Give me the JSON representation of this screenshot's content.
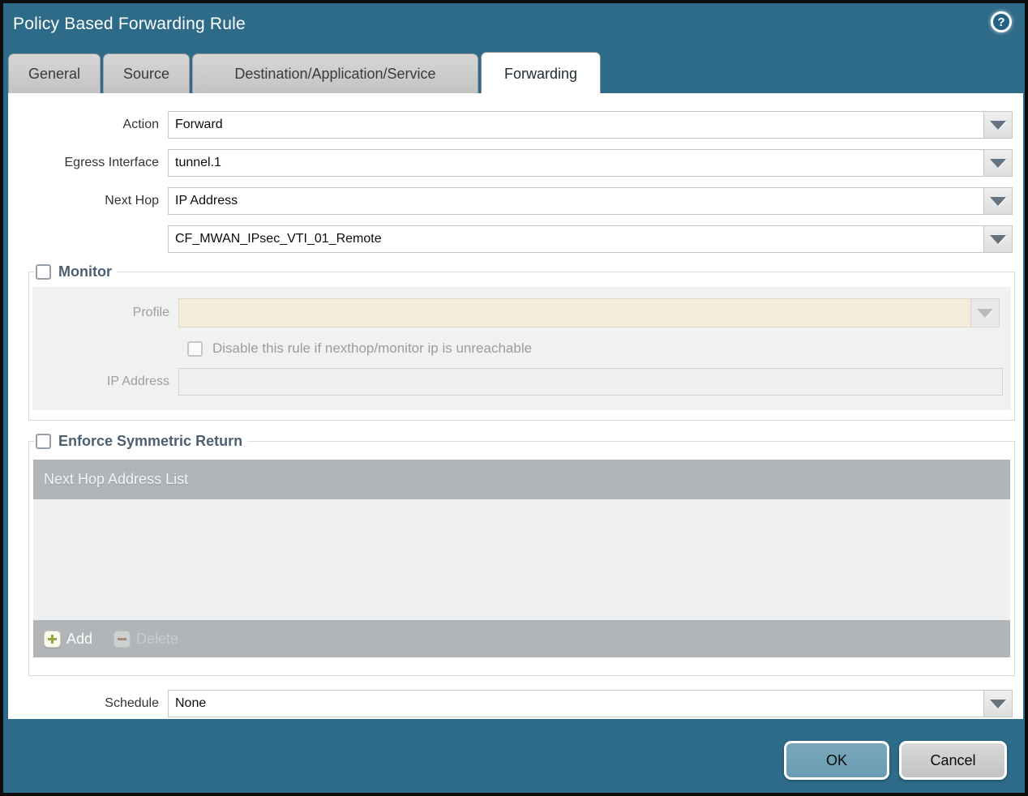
{
  "dialog": {
    "title": "Policy Based Forwarding Rule"
  },
  "icons": {
    "help_glyph": "?"
  },
  "tabs": [
    {
      "label": "General",
      "active": false
    },
    {
      "label": "Source",
      "active": false
    },
    {
      "label": "Destination/Application/Service",
      "active": false
    },
    {
      "label": "Forwarding",
      "active": true
    }
  ],
  "form": {
    "action": {
      "label": "Action",
      "value": "Forward"
    },
    "egress_interface": {
      "label": "Egress Interface",
      "value": "tunnel.1"
    },
    "next_hop": {
      "label": "Next Hop",
      "value": "IP Address"
    },
    "next_hop_address": {
      "value": "CF_MWAN_IPsec_VTI_01_Remote"
    },
    "schedule": {
      "label": "Schedule",
      "value": "None"
    }
  },
  "monitor": {
    "legend": "Monitor",
    "checked": false,
    "profile": {
      "label": "Profile",
      "value": ""
    },
    "disable_rule_checkbox": {
      "label": "Disable this rule if nexthop/monitor ip is unreachable",
      "checked": false
    },
    "ip_address": {
      "label": "IP Address",
      "value": ""
    }
  },
  "enforce_symmetric_return": {
    "legend": "Enforce Symmetric Return",
    "checked": false,
    "table_header": "Next Hop Address List",
    "rows": [],
    "add_label": "Add",
    "delete_label": "Delete"
  },
  "buttons": {
    "ok": "OK",
    "cancel": "Cancel"
  },
  "colors": {
    "chrome_teal": "#2e6b88",
    "active_tab_bg": "#ffffff",
    "inactive_tab_bg": "#c9c9c9",
    "legend_text": "#4d6071",
    "table_gray": "#b1b5b8",
    "table_body": "#edeff0",
    "disabled_panel": "#f1f1ef",
    "profile_field_cream": "#f3ecd8",
    "ok_button": "#6fa2b8",
    "cancel_button": "#c9cacb",
    "add_plus_green": "#94a83e",
    "delete_minus_brown": "#aa8a74"
  }
}
